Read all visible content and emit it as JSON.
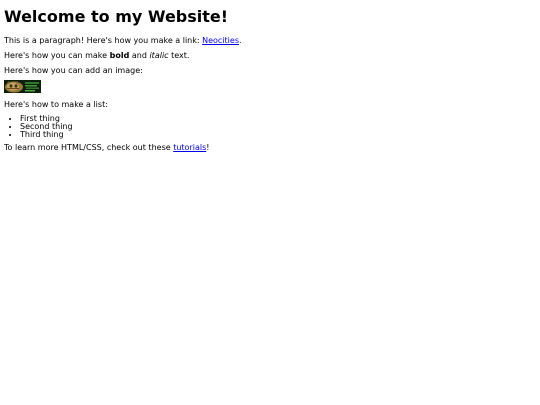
{
  "heading": "Welcome to my Website!",
  "para1": {
    "text_before": "This is a paragraph! Here's how you make a link: ",
    "link": "Neocities",
    "text_after": "."
  },
  "para2": {
    "text_before": "Here's how you can make ",
    "bold": "bold",
    "text_middle": " and ",
    "italic": "italic",
    "text_after": " text."
  },
  "para3": "Here's how you can add an image:",
  "image_icon": "site-image-icon",
  "para4": "Here's how to make a list:",
  "list": [
    "First thing",
    "Second thing",
    "Third thing"
  ],
  "para5": {
    "text_before": "To learn more HTML/CSS, check out these ",
    "link": "tutorials",
    "text_after": "!"
  },
  "colors": {
    "link": "#0000ee",
    "text": "#000000",
    "background": "#ffffff"
  }
}
